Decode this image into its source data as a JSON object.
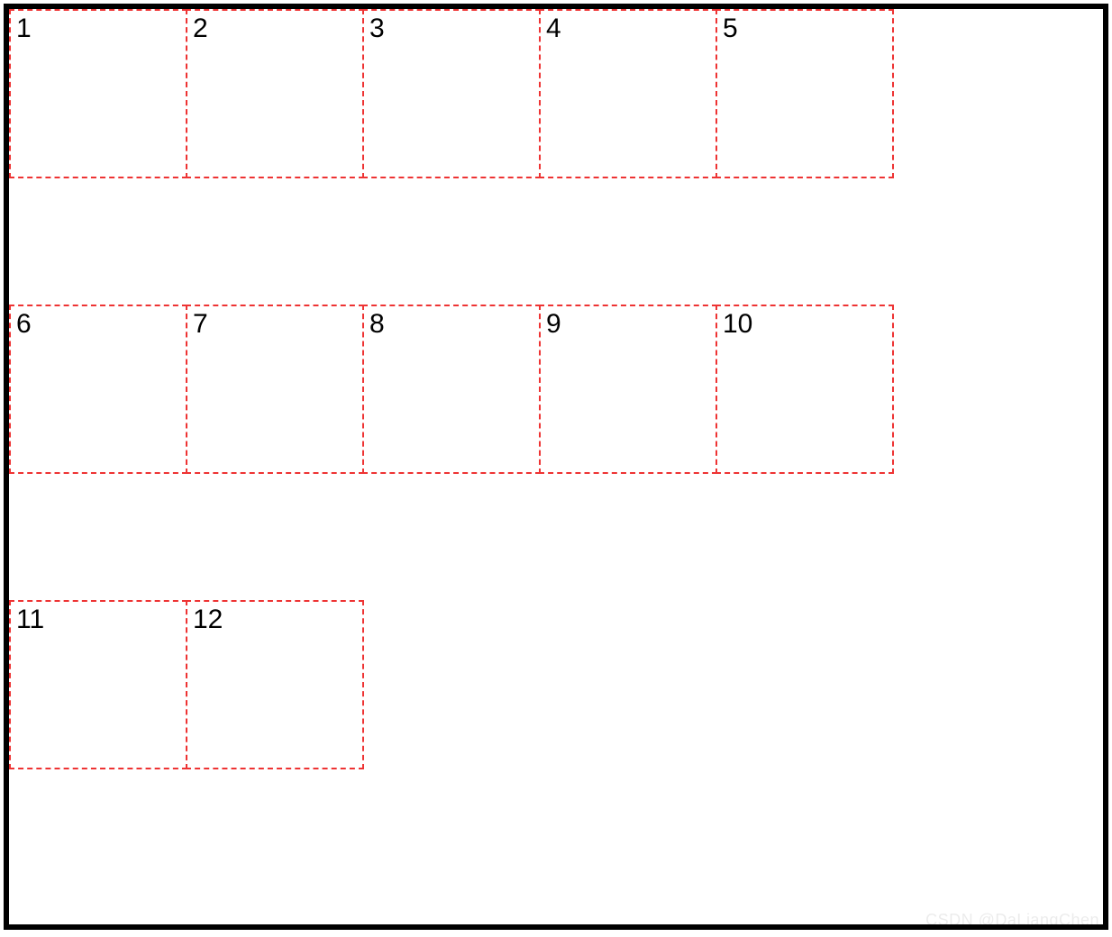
{
  "grid": {
    "rows": [
      {
        "cells": [
          "1",
          "2",
          "3",
          "4",
          "5"
        ]
      },
      {
        "cells": [
          "6",
          "7",
          "8",
          "9",
          "10"
        ]
      },
      {
        "cells": [
          "11",
          "12"
        ]
      }
    ]
  },
  "watermark": "CSDN @DaLiangChen"
}
